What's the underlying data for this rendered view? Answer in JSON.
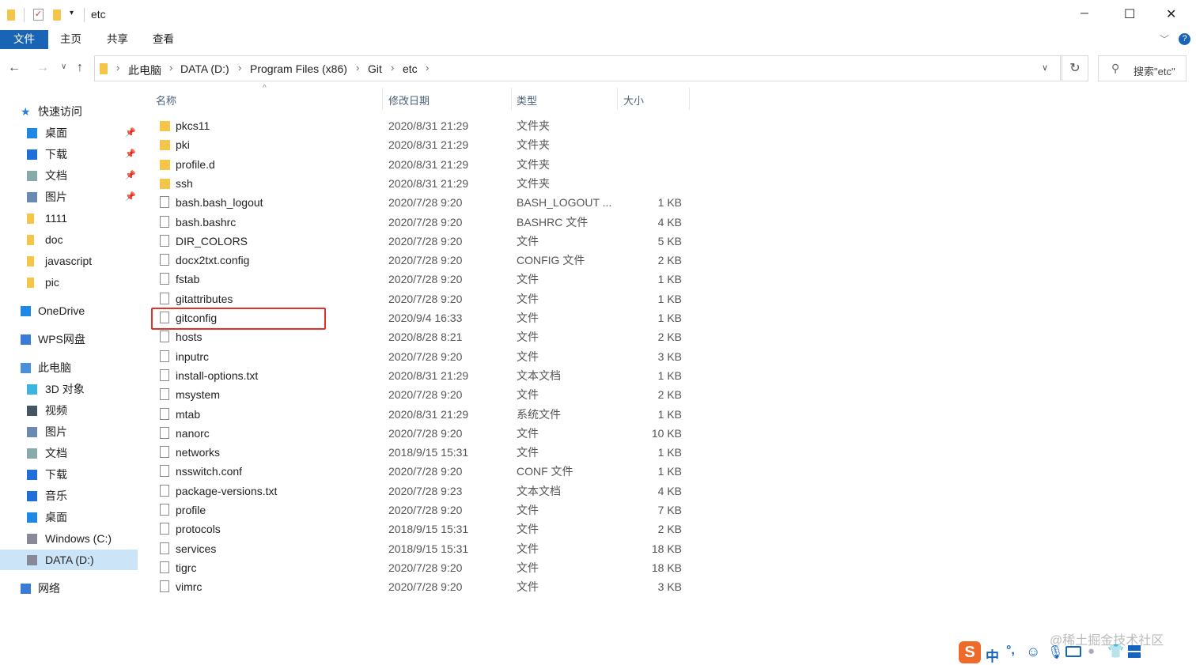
{
  "window": {
    "title": "etc",
    "minimize": "─",
    "maximize": "☐",
    "close": "✕"
  },
  "ribbon": {
    "tabs": [
      "文件",
      "主页",
      "共享",
      "查看"
    ]
  },
  "address": {
    "crumbs": [
      "此电脑",
      "DATA (D:)",
      "Program Files (x86)",
      "Git",
      "etc"
    ],
    "search_placeholder": "搜索\"etc\""
  },
  "columns": {
    "name": "名称",
    "date": "修改日期",
    "type": "类型",
    "size": "大小"
  },
  "sidebar": [
    {
      "label": "快速访问",
      "icon": "star-icon",
      "indent": 0,
      "color": "#2a7fd4"
    },
    {
      "label": "桌面",
      "icon": "desktop-icon",
      "indent": 1,
      "pin": true,
      "color": "#1e88e5"
    },
    {
      "label": "下载",
      "icon": "download-icon",
      "indent": 1,
      "pin": true,
      "color": "#1e6fd9"
    },
    {
      "label": "文档",
      "icon": "document-icon",
      "indent": 1,
      "pin": true,
      "color": "#8aa"
    },
    {
      "label": "图片",
      "icon": "picture-icon",
      "indent": 1,
      "pin": true,
      "color": "#6a8ab0"
    },
    {
      "label": "1111",
      "icon": "folder-icon",
      "indent": 1,
      "color": "#f3c64a"
    },
    {
      "label": "doc",
      "icon": "folder-icon",
      "indent": 1,
      "color": "#f3c64a"
    },
    {
      "label": "javascript",
      "icon": "folder-icon",
      "indent": 1,
      "color": "#f3c64a"
    },
    {
      "label": "pic",
      "icon": "folder-icon",
      "indent": 1,
      "color": "#f3c64a"
    },
    {
      "label": "OneDrive",
      "icon": "cloud-icon",
      "indent": 0,
      "color": "#1e88e5",
      "gap": true
    },
    {
      "label": "WPS网盘",
      "icon": "cloud-icon",
      "indent": 0,
      "color": "#3a7bd5",
      "gap": true
    },
    {
      "label": "此电脑",
      "icon": "computer-icon",
      "indent": 0,
      "color": "#4a90d9",
      "gap": true
    },
    {
      "label": "3D 对象",
      "icon": "cube-icon",
      "indent": 1,
      "color": "#3bb5e0"
    },
    {
      "label": "视频",
      "icon": "video-icon",
      "indent": 1,
      "color": "#456"
    },
    {
      "label": "图片",
      "icon": "picture-icon",
      "indent": 1,
      "color": "#6a8ab0"
    },
    {
      "label": "文档",
      "icon": "document-icon",
      "indent": 1,
      "color": "#8aa"
    },
    {
      "label": "下载",
      "icon": "download-icon",
      "indent": 1,
      "color": "#1e6fd9"
    },
    {
      "label": "音乐",
      "icon": "music-icon",
      "indent": 1,
      "color": "#1e6fd9"
    },
    {
      "label": "桌面",
      "icon": "desktop-icon",
      "indent": 1,
      "color": "#1e88e5"
    },
    {
      "label": "Windows (C:)",
      "icon": "drive-icon",
      "indent": 1,
      "color": "#889"
    },
    {
      "label": "DATA (D:)",
      "icon": "drive-icon",
      "indent": 1,
      "color": "#889",
      "selected": true
    },
    {
      "label": "网络",
      "icon": "network-icon",
      "indent": 0,
      "color": "#3a7bd5",
      "gap": true
    }
  ],
  "files": [
    {
      "name": "pkcs11",
      "date": "2020/8/31 21:29",
      "type": "文件夹",
      "size": "",
      "dir": true
    },
    {
      "name": "pki",
      "date": "2020/8/31 21:29",
      "type": "文件夹",
      "size": "",
      "dir": true
    },
    {
      "name": "profile.d",
      "date": "2020/8/31 21:29",
      "type": "文件夹",
      "size": "",
      "dir": true
    },
    {
      "name": "ssh",
      "date": "2020/8/31 21:29",
      "type": "文件夹",
      "size": "",
      "dir": true
    },
    {
      "name": "bash.bash_logout",
      "date": "2020/7/28 9:20",
      "type": "BASH_LOGOUT ...",
      "size": "1 KB"
    },
    {
      "name": "bash.bashrc",
      "date": "2020/7/28 9:20",
      "type": "BASHRC 文件",
      "size": "4 KB"
    },
    {
      "name": "DIR_COLORS",
      "date": "2020/7/28 9:20",
      "type": "文件",
      "size": "5 KB"
    },
    {
      "name": "docx2txt.config",
      "date": "2020/7/28 9:20",
      "type": "CONFIG 文件",
      "size": "2 KB"
    },
    {
      "name": "fstab",
      "date": "2020/7/28 9:20",
      "type": "文件",
      "size": "1 KB"
    },
    {
      "name": "gitattributes",
      "date": "2020/7/28 9:20",
      "type": "文件",
      "size": "1 KB"
    },
    {
      "name": "gitconfig",
      "date": "2020/9/4 16:33",
      "type": "文件",
      "size": "1 KB"
    },
    {
      "name": "hosts",
      "date": "2020/8/28 8:21",
      "type": "文件",
      "size": "2 KB"
    },
    {
      "name": "inputrc",
      "date": "2020/7/28 9:20",
      "type": "文件",
      "size": "3 KB"
    },
    {
      "name": "install-options.txt",
      "date": "2020/8/31 21:29",
      "type": "文本文档",
      "size": "1 KB"
    },
    {
      "name": "msystem",
      "date": "2020/7/28 9:20",
      "type": "文件",
      "size": "2 KB"
    },
    {
      "name": "mtab",
      "date": "2020/8/31 21:29",
      "type": "系统文件",
      "size": "1 KB"
    },
    {
      "name": "nanorc",
      "date": "2020/7/28 9:20",
      "type": "文件",
      "size": "10 KB"
    },
    {
      "name": "networks",
      "date": "2018/9/15 15:31",
      "type": "文件",
      "size": "1 KB"
    },
    {
      "name": "nsswitch.conf",
      "date": "2020/7/28 9:20",
      "type": "CONF 文件",
      "size": "1 KB"
    },
    {
      "name": "package-versions.txt",
      "date": "2020/7/28 9:23",
      "type": "文本文档",
      "size": "4 KB"
    },
    {
      "name": "profile",
      "date": "2020/7/28 9:20",
      "type": "文件",
      "size": "7 KB"
    },
    {
      "name": "protocols",
      "date": "2018/9/15 15:31",
      "type": "文件",
      "size": "2 KB"
    },
    {
      "name": "services",
      "date": "2018/9/15 15:31",
      "type": "文件",
      "size": "18 KB"
    },
    {
      "name": "tigrc",
      "date": "2020/7/28 9:20",
      "type": "文件",
      "size": "18 KB"
    },
    {
      "name": "vimrc",
      "date": "2020/7/28 9:20",
      "type": "文件",
      "size": "3 KB"
    }
  ],
  "watermark": "@稀土掘金技术社区",
  "ime": {
    "lang": "中",
    "punct": "°,"
  },
  "accent": "#1a64b5",
  "highlight": "#e0312b"
}
